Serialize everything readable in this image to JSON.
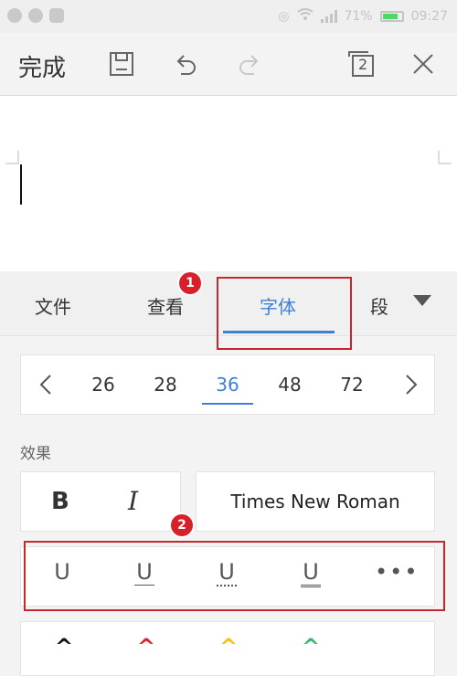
{
  "status_bar": {
    "battery": "71%",
    "time": "09:27"
  },
  "toolbar": {
    "done_label": "完成",
    "page_count": "2",
    "icons": [
      "save-icon",
      "undo-icon",
      "redo-icon",
      "pages-icon",
      "close-icon"
    ]
  },
  "tabs": {
    "items": [
      "文件",
      "查看",
      "字体",
      "段"
    ],
    "active": "字体"
  },
  "annotations": {
    "badge_1": "1",
    "badge_2": "2"
  },
  "font_sizes": {
    "values": [
      "26",
      "28",
      "36",
      "48",
      "72"
    ],
    "selected": "36"
  },
  "effects": {
    "label": "效果",
    "bold": "B",
    "italic": "I",
    "font_name": "Times New Roman"
  },
  "underline_styles": {
    "symbol": "U",
    "items": [
      "single-underline",
      "thin-underline",
      "dotted-underline",
      "double-underline"
    ],
    "more": "•••"
  },
  "font_colors": {
    "glyph": "^",
    "colors": [
      "#111111",
      "#e0202a",
      "#f4c20d",
      "#3cb371"
    ]
  },
  "colors": {
    "accent": "#3f7fd6",
    "annotation": "#c7262f"
  }
}
